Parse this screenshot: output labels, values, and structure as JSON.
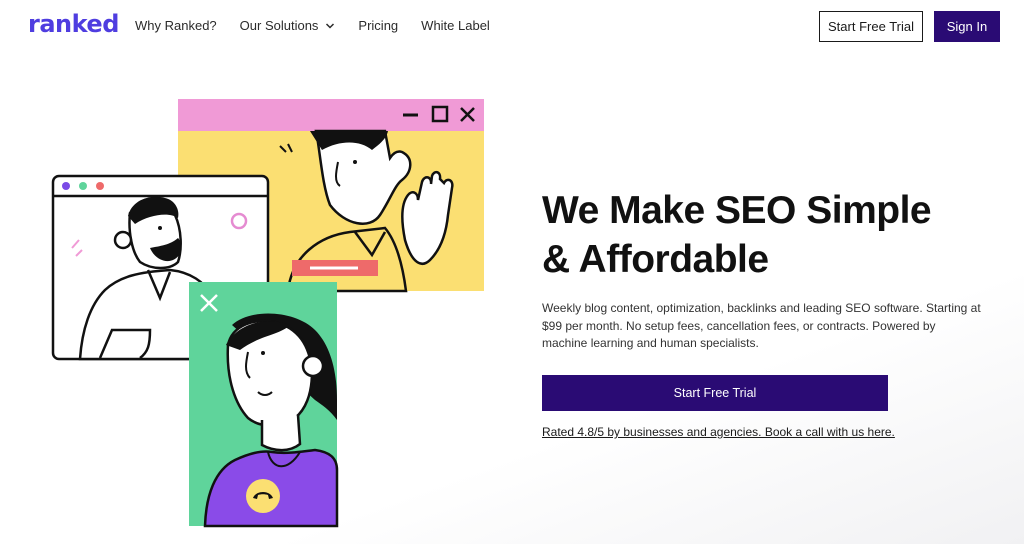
{
  "brand": {
    "logo_text": "ranked",
    "accent": "#4f3de0",
    "button_color": "#2a0b74"
  },
  "nav": {
    "links": [
      {
        "label": "Why Ranked?"
      },
      {
        "label": "Our Solutions",
        "icon": "chevron-down-icon"
      },
      {
        "label": "Pricing"
      },
      {
        "label": "White Label"
      }
    ],
    "start_trial_label": "Start Free Trial",
    "sign_in_label": "Sign In"
  },
  "hero": {
    "title_line1": "We Make SEO Simple",
    "title_line2": "& Affordable",
    "description": "Weekly blog content, optimization, backlinks and leading SEO software. Starting at $99 per month. No setup fees, cancellation fees, or contracts. Powered by machine learning and human specialists.",
    "cta_label": "Start Free Trial",
    "rating_text": "Rated 4.8/5 by businesses and agencies. Book a call with us here."
  },
  "illustration": {
    "icons": [
      "minimize-icon",
      "maximize-icon",
      "close-icon",
      "hang-up-icon"
    ],
    "colors": {
      "pink": "#f09ad6",
      "yellow": "#fbdf72",
      "green": "#5fd49b",
      "purple": "#8a4be8",
      "red": "#ee6a6a"
    }
  }
}
